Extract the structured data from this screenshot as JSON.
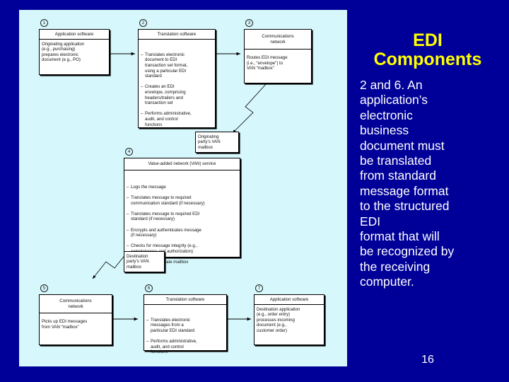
{
  "slide": {
    "background_color": "#000099",
    "title": "EDI\nComponents",
    "title_color": "#ffff00",
    "body_text": "2 and 6. An\napplication’s\nelectronic\nbusiness\ndocument must\nbe translated\nfrom standard\nmessage  format\nto the structured\nEDI\nformat that will\nbe recognized by\nthe receiving\ncomputer.",
    "body_color": "#ffffff",
    "number": "16"
  },
  "diagram": {
    "background_color": "#d6f7fb",
    "steps": [
      {
        "num": "1",
        "header": "Application software",
        "body": "Originating application\n(e.g., purchasing)\nprepares electronic\ndocument (e.g., PO)"
      },
      {
        "num": "2",
        "header": "Translation software",
        "bullets": [
          "Translates electronic\ndocument to EDI\ntransaction set format,\nusing a particular EDI\nstandard",
          "Creates an EDI\nenvelope, comprising\nheaders/trailers and\ntransaction set",
          "Performs administrative,\naudit, and control\nfunctions"
        ]
      },
      {
        "num": "3",
        "header": "Communications\nnetwork",
        "body": "Routes EDI message\n(i.e., “envelope”) to\nVAN “mailbox”"
      },
      {
        "num": "4",
        "header": "Value-added network (VAN) service",
        "bullets": [
          "Logs the message",
          "Translates message to required\ncommunication standard (if necessary)",
          "Translates message to required EDI\nstandard (if necessary)",
          "Encrypts and authenticates message\n(if necessary)",
          "Checks for message integrity (e.g.,\ncompleteness and authorization)",
          "Routes to appropriate mailbox"
        ]
      },
      {
        "num": "5",
        "header": "Communications\nnetwork",
        "body": "Picks up EDI messages\nfrom VAN “mailbox”"
      },
      {
        "num": "6",
        "header": "Translation software",
        "bullets": [
          "Translates electronic\nmessages from a\nparticular EDI standard",
          "Performs administrative,\naudit, and control\nfunctions"
        ]
      },
      {
        "num": "7",
        "header": "Application software",
        "body": "Destination application\n(e.g., order entry)\nprocesses incoming\ndocument (e.g.,\ncustomer order)"
      }
    ],
    "mailboxes": {
      "originating": "Originating\nparty’s VAN\nmailbox",
      "destination": "Destination\nparty’s VAN\nmailbox"
    }
  }
}
